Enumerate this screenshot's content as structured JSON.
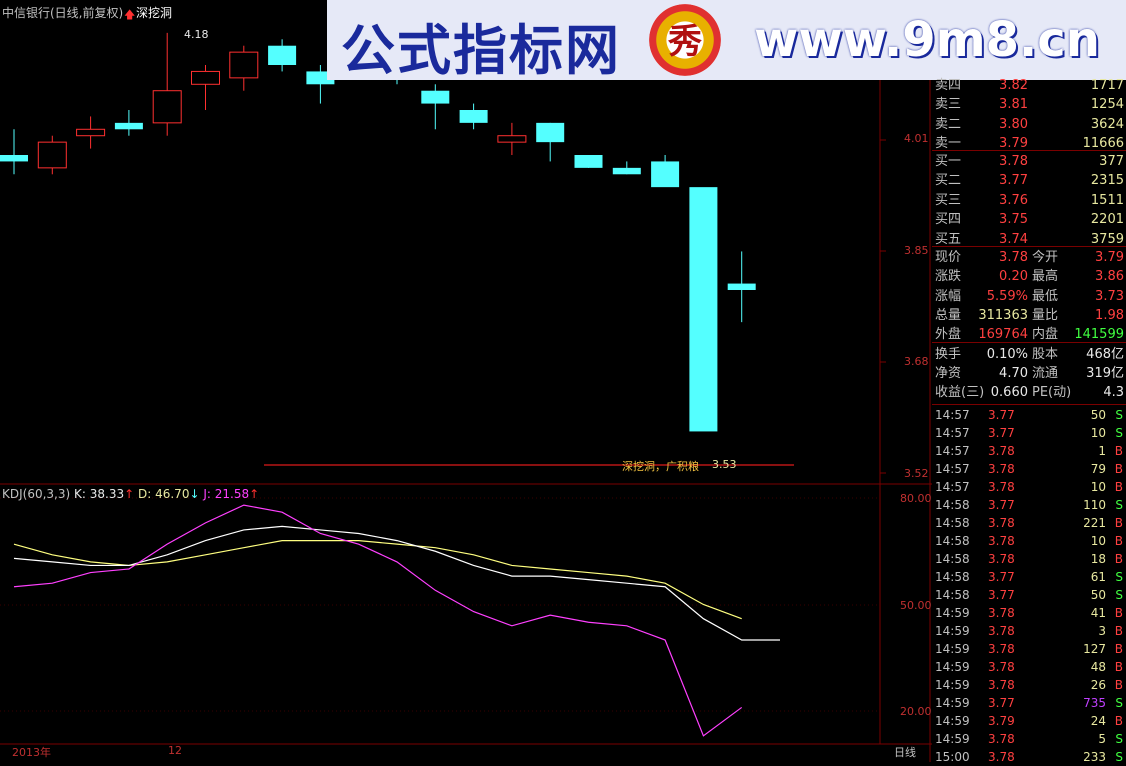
{
  "header": {
    "stock_title": "中信银行(日线,前复权)",
    "indicator_name": "深挖洞",
    "high_label": "4.18"
  },
  "banner": {
    "site_name": "公式指标网",
    "logo_char": "秀",
    "url": "www.9m8.cn"
  },
  "price_axis": [
    "4.01",
    "3.85",
    "3.68",
    "3.52"
  ],
  "kdj": {
    "label": "KDJ(60,3,3)",
    "k": "K: 38.33",
    "d": "D: 46.70",
    "j": "J: 21.58",
    "axis": [
      "80.00",
      "50.00",
      "20.00"
    ]
  },
  "annotation": {
    "text": "深挖洞，广积粮",
    "value": "3.53"
  },
  "time_axis": {
    "year": "2013年",
    "month": "12",
    "period": "日线"
  },
  "colors": {
    "up": "#ff3030",
    "down": "#54ffff",
    "k_line": "#ffffff",
    "d_line": "#ffff80",
    "j_line": "#ff40ff"
  },
  "chart_data": {
    "type": "candlestick",
    "ylim": [
      3.5,
      4.2
    ],
    "candles": [
      {
        "o": 3.99,
        "h": 4.03,
        "l": 3.96,
        "c": 3.98
      },
      {
        "o": 3.97,
        "h": 4.02,
        "l": 3.96,
        "c": 4.01
      },
      {
        "o": 4.02,
        "h": 4.05,
        "l": 4.0,
        "c": 4.03
      },
      {
        "o": 4.04,
        "h": 4.06,
        "l": 4.02,
        "c": 4.03
      },
      {
        "o": 4.04,
        "h": 4.18,
        "l": 4.02,
        "c": 4.09
      },
      {
        "o": 4.1,
        "h": 4.13,
        "l": 4.06,
        "c": 4.12
      },
      {
        "o": 4.11,
        "h": 4.16,
        "l": 4.09,
        "c": 4.15
      },
      {
        "o": 4.16,
        "h": 4.17,
        "l": 4.12,
        "c": 4.13
      },
      {
        "o": 4.12,
        "h": 4.13,
        "l": 4.07,
        "c": 4.1
      },
      {
        "o": 4.12,
        "h": 4.13,
        "l": 4.11,
        "c": 4.12
      },
      {
        "o": 4.12,
        "h": 4.13,
        "l": 4.1,
        "c": 4.11
      },
      {
        "o": 4.09,
        "h": 4.1,
        "l": 4.03,
        "c": 4.07
      },
      {
        "o": 4.06,
        "h": 4.07,
        "l": 4.03,
        "c": 4.04
      },
      {
        "o": 4.01,
        "h": 4.04,
        "l": 3.99,
        "c": 4.02
      },
      {
        "o": 4.04,
        "h": 4.04,
        "l": 3.98,
        "c": 4.01
      },
      {
        "o": 3.99,
        "h": 3.99,
        "l": 3.97,
        "c": 3.97
      },
      {
        "o": 3.97,
        "h": 3.98,
        "l": 3.96,
        "c": 3.96
      },
      {
        "o": 3.98,
        "h": 3.99,
        "l": 3.95,
        "c": 3.94
      },
      {
        "o": 3.94,
        "h": 3.93,
        "l": 3.58,
        "c": 3.56
      },
      {
        "o": 3.79,
        "h": 3.84,
        "l": 3.73,
        "c": 3.78
      }
    ],
    "kdj_k": [
      63,
      62,
      61,
      61,
      64,
      68,
      71,
      72,
      71,
      70,
      68,
      65,
      61,
      58,
      58,
      57,
      56,
      55,
      46,
      40,
      40
    ],
    "kdj_d": [
      67,
      64,
      62,
      61,
      62,
      64,
      66,
      68,
      68,
      68,
      67,
      66,
      64,
      61,
      60,
      59,
      58,
      56,
      50,
      46
    ],
    "kdj_j": [
      55,
      56,
      59,
      60,
      67,
      73,
      78,
      76,
      70,
      67,
      62,
      54,
      48,
      44,
      47,
      45,
      44,
      40,
      13,
      21
    ]
  },
  "quote_panel": {
    "sells": [
      {
        "label": "卖四",
        "price": "3.82",
        "vol": "1717"
      },
      {
        "label": "卖三",
        "price": "3.81",
        "vol": "1254"
      },
      {
        "label": "卖二",
        "price": "3.80",
        "vol": "3624"
      },
      {
        "label": "卖一",
        "price": "3.79",
        "vol": "11666"
      }
    ],
    "buys": [
      {
        "label": "买一",
        "price": "3.78",
        "vol": "377"
      },
      {
        "label": "买二",
        "price": "3.77",
        "vol": "2315"
      },
      {
        "label": "买三",
        "price": "3.76",
        "vol": "1511"
      },
      {
        "label": "买四",
        "price": "3.75",
        "vol": "2201"
      },
      {
        "label": "买五",
        "price": "3.74",
        "vol": "3759"
      }
    ],
    "stats": [
      {
        "l1": "现价",
        "v1": "3.78",
        "c1": "#ff4040",
        "l2": "今开",
        "v2": "3.79",
        "c2": "#ff4040"
      },
      {
        "l1": "涨跌",
        "v1": "0.20",
        "c1": "#ff4040",
        "l2": "最高",
        "v2": "3.86",
        "c2": "#ff4040"
      },
      {
        "l1": "涨幅",
        "v1": "5.59%",
        "c1": "#ff4040",
        "l2": "最低",
        "v2": "3.73",
        "c2": "#ff4040"
      },
      {
        "l1": "总量",
        "v1": "311363",
        "c1": "#e8e8a0",
        "l2": "量比",
        "v2": "1.98",
        "c2": "#ff4040"
      },
      {
        "l1": "外盘",
        "v1": "169764",
        "c1": "#ff4040",
        "l2": "内盘",
        "v2": "141599",
        "c2": "#40ff40"
      },
      {
        "l1": "换手",
        "v1": "0.10%",
        "c1": "#e8e8e8",
        "l2": "股本",
        "v2": "468亿",
        "c2": "#e8e8e8"
      },
      {
        "l1": "净资",
        "v1": "4.70",
        "c1": "#e8e8e8",
        "l2": "流通",
        "v2": "319亿",
        "c2": "#e8e8e8"
      },
      {
        "l1": "收益(三)",
        "v1": "0.660",
        "c1": "#e8e8e8",
        "l2": "PE(动)",
        "v2": "4.3",
        "c2": "#e8e8e8"
      }
    ],
    "ticks": [
      {
        "t": "14:57",
        "p": "3.77",
        "v": "50",
        "s": "S"
      },
      {
        "t": "14:57",
        "p": "3.77",
        "v": "10",
        "s": "S"
      },
      {
        "t": "14:57",
        "p": "3.78",
        "v": "1",
        "s": "B"
      },
      {
        "t": "14:57",
        "p": "3.78",
        "v": "79",
        "s": "B"
      },
      {
        "t": "14:57",
        "p": "3.78",
        "v": "10",
        "s": "B"
      },
      {
        "t": "14:58",
        "p": "3.77",
        "v": "110",
        "s": "S"
      },
      {
        "t": "14:58",
        "p": "3.78",
        "v": "221",
        "s": "B"
      },
      {
        "t": "14:58",
        "p": "3.78",
        "v": "10",
        "s": "B"
      },
      {
        "t": "14:58",
        "p": "3.78",
        "v": "18",
        "s": "B"
      },
      {
        "t": "14:58",
        "p": "3.77",
        "v": "61",
        "s": "S"
      },
      {
        "t": "14:58",
        "p": "3.77",
        "v": "50",
        "s": "S"
      },
      {
        "t": "14:59",
        "p": "3.78",
        "v": "41",
        "s": "B"
      },
      {
        "t": "14:59",
        "p": "3.78",
        "v": "3",
        "s": "B"
      },
      {
        "t": "14:59",
        "p": "3.78",
        "v": "127",
        "s": "B"
      },
      {
        "t": "14:59",
        "p": "3.78",
        "v": "48",
        "s": "B"
      },
      {
        "t": "14:59",
        "p": "3.78",
        "v": "26",
        "s": "B"
      },
      {
        "t": "14:59",
        "p": "3.77",
        "v": "735",
        "s": "S"
      },
      {
        "t": "14:59",
        "p": "3.79",
        "v": "24",
        "s": "B"
      },
      {
        "t": "14:59",
        "p": "3.78",
        "v": "5",
        "s": "S"
      },
      {
        "t": "15:00",
        "p": "3.78",
        "v": "233",
        "s": "S"
      }
    ]
  }
}
